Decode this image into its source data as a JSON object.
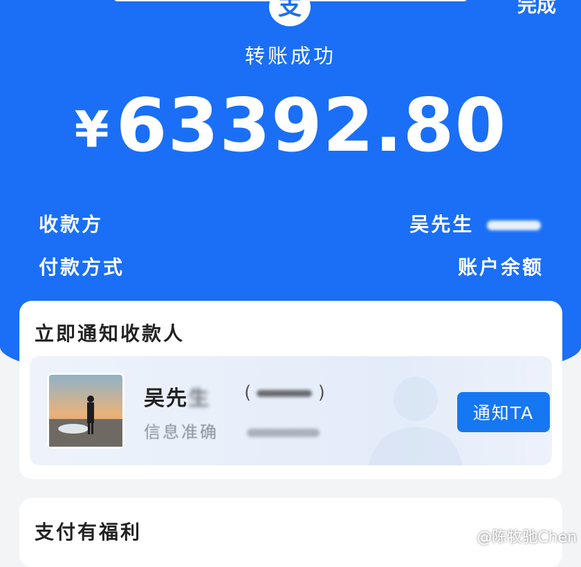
{
  "header": {
    "logo_glyph": "支",
    "done_label": "完成",
    "status_text": "转账成功",
    "currency_symbol": "¥",
    "amount": "63392.80",
    "brand_color": "#1a6ff6"
  },
  "details": {
    "payee_label": "收款方",
    "payee_value": "吴先生",
    "payment_method_label": "付款方式",
    "payment_method_value": "账户余额"
  },
  "notify_card": {
    "title": "立即通知收款人",
    "payee_name": "吴先",
    "payee_name_blur": "生",
    "payee_account_open": "(",
    "payee_account_close": ")",
    "payee_subtitle": "信息准确",
    "notify_button_label": "通知TA",
    "avatar_icon": "avatar-photo"
  },
  "benefits_card": {
    "title": "支付有福利"
  },
  "watermark": {
    "text": "@陈牧驰Chen"
  }
}
